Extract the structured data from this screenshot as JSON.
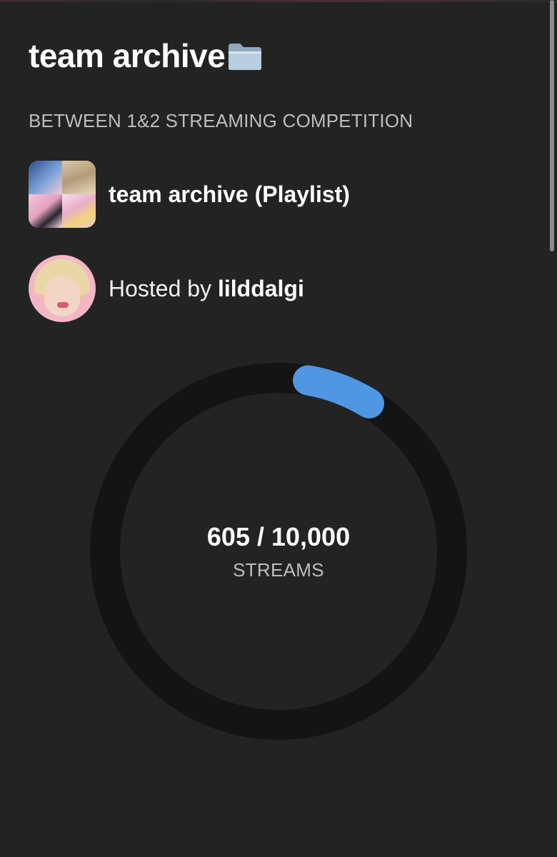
{
  "header": {
    "title": "team archive",
    "title_icon": "file-folder-icon",
    "subtitle": "BETWEEN 1&2 STREAMING COMPETITION"
  },
  "playlist": {
    "label": "team archive (Playlist)",
    "cover_icon": "playlist-cover-image"
  },
  "host": {
    "prefix": "Hosted by ",
    "name": "lilddalgi",
    "avatar_icon": "host-avatar-image"
  },
  "progress": {
    "count_text": "605 / 10,000",
    "unit": "STREAMS",
    "current": 605,
    "goal": 10000,
    "fraction": 0.0605,
    "track_color": "#141414",
    "fill_color": "#4f97e3"
  },
  "colors": {
    "background": "#232323",
    "text_primary": "#ffffff",
    "text_secondary": "#bdbdbd"
  }
}
